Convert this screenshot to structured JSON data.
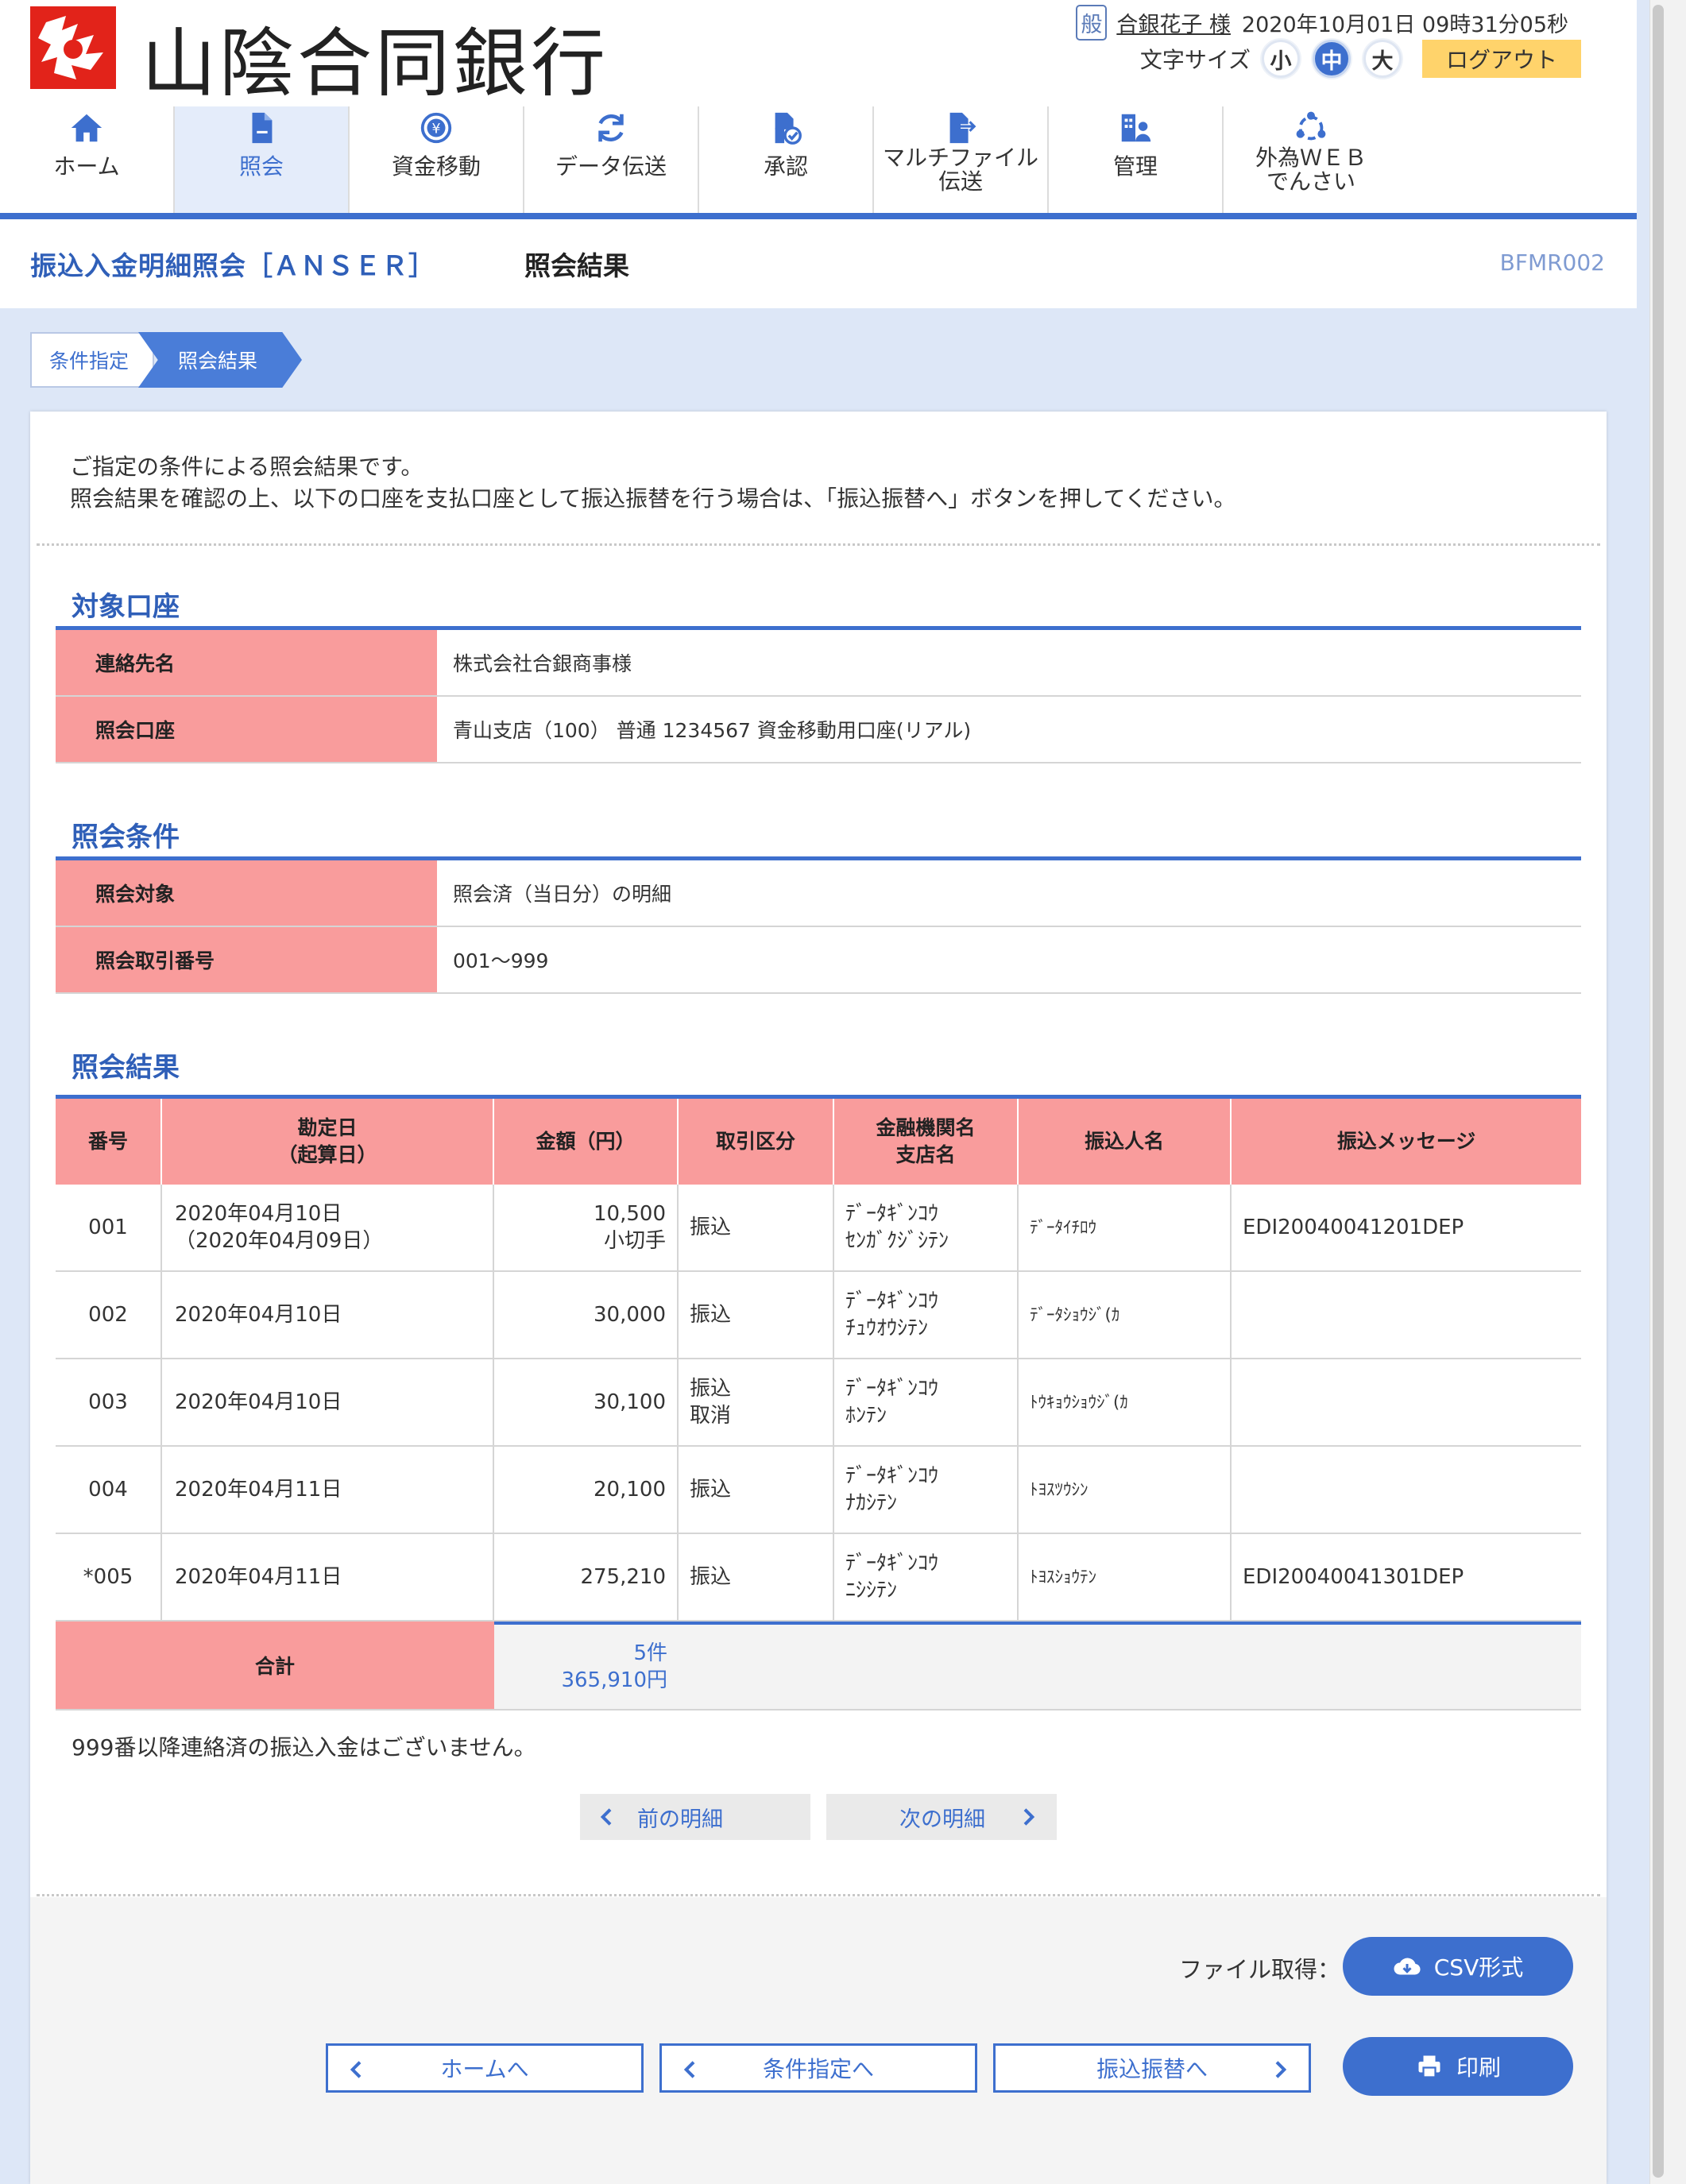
{
  "header": {
    "bank_name": "山陰合同銀行",
    "user_badge": "般",
    "user_name": "合銀花子 様",
    "datetime": "2020年10月01日 09時31分05秒",
    "font_size_label": "文字サイズ",
    "font_sizes": [
      "小",
      "中",
      "大"
    ],
    "font_size_selected": "中",
    "logout": "ログアウト"
  },
  "nav": {
    "items": [
      {
        "label": "ホーム",
        "icon": "home-icon"
      },
      {
        "label": "照会",
        "icon": "document-icon"
      },
      {
        "label": "資金移動",
        "icon": "yen-transfer-icon"
      },
      {
        "label": "データ伝送",
        "icon": "sync-icon"
      },
      {
        "label": "承認",
        "icon": "approve-document-icon"
      },
      {
        "label": "マルチファイル",
        "label2": "伝送",
        "icon": "file-upload-icon"
      },
      {
        "label": "管理",
        "icon": "admin-user-icon"
      },
      {
        "label": "外為ＷＥＢ",
        "label2": "でんさい",
        "icon": "network-icon"
      }
    ],
    "active": "照会"
  },
  "title": {
    "main": "振込入金明細照会［ＡＮＳＥＲ］",
    "sub": "照会結果",
    "screen_id": "BFMR002"
  },
  "steps": [
    "条件指定",
    "照会結果"
  ],
  "intro": {
    "line1": "ご指定の条件による照会結果です。",
    "line2": "照会結果を確認の上、以下の口座を支払口座として振込振替を行う場合は、「振込振替へ」ボタンを押してください。"
  },
  "target_account": {
    "title": "対象口座",
    "rows": [
      {
        "key": "連絡先名",
        "value": "株式会社合銀商事様"
      },
      {
        "key": "照会口座",
        "value": "青山支店（100） 普通 1234567 資金移動用口座(リアル)"
      }
    ]
  },
  "conditions": {
    "title": "照会条件",
    "rows": [
      {
        "key": "照会対象",
        "value": "照会済（当日分）の明細"
      },
      {
        "key": "照会取引番号",
        "value": "001～999"
      }
    ]
  },
  "results": {
    "title": "照会結果",
    "headers": {
      "no": "番号",
      "date": "勘定日",
      "date2": "（起算日）",
      "amount": "金額（円）",
      "type": "取引区分",
      "bank": "金融機関名",
      "bank2": "支店名",
      "payer": "振込人名",
      "message": "振込メッセージ"
    },
    "rows": [
      {
        "no": "001",
        "date": "2020年04月10日",
        "date2": "（2020年04月09日）",
        "amount": "10,500",
        "amount2": "小切手",
        "type": "振込",
        "type2": "",
        "bank": "ﾃﾞｰﾀｷﾞﾝｺｳ",
        "branch": "ｾﾝｶﾞｸｼﾞｼﾃﾝ",
        "payer": "ﾃﾞｰﾀｲﾁﾛｳ",
        "message": "EDI20040041201DEP"
      },
      {
        "no": "002",
        "date": "2020年04月10日",
        "date2": "",
        "amount": "30,000",
        "amount2": "",
        "type": "振込",
        "type2": "",
        "bank": "ﾃﾞｰﾀｷﾞﾝｺｳ",
        "branch": "ﾁｭｳｵｳｼﾃﾝ",
        "payer": "ﾃﾞｰﾀｼｮｳｼﾞ(ｶ",
        "message": ""
      },
      {
        "no": "003",
        "date": "2020年04月10日",
        "date2": "",
        "amount": "30,100",
        "amount2": "",
        "type": "振込",
        "type2": "取消",
        "bank": "ﾃﾞｰﾀｷﾞﾝｺｳ",
        "branch": "ﾎﾝﾃﾝ",
        "payer": "ﾄｳｷｮｳｼｮｳｼﾞ(ｶ",
        "message": ""
      },
      {
        "no": "004",
        "date": "2020年04月11日",
        "date2": "",
        "amount": "20,100",
        "amount2": "",
        "type": "振込",
        "type2": "",
        "bank": "ﾃﾞｰﾀｷﾞﾝｺｳ",
        "branch": "ﾅｶｼﾃﾝ",
        "payer": "ﾄﾖｽﾂｳｼﾝ",
        "message": ""
      },
      {
        "no": "*005",
        "date": "2020年04月11日",
        "date2": "",
        "amount": "275,210",
        "amount2": "",
        "type": "振込",
        "type2": "",
        "bank": "ﾃﾞｰﾀｷﾞﾝｺｳ",
        "branch": "ﾆｼｼﾃﾝ",
        "payer": "ﾄﾖｽｼｮｳﾃﾝ",
        "message": "EDI20040041301DEP"
      }
    ],
    "total_label": "合計",
    "total_count": "5件",
    "total_amount": "365,910円"
  },
  "no_more_notice": "999番以降連絡済の振込入金はございません。",
  "paging": {
    "prev": "前の明細",
    "next": "次の明細"
  },
  "footer": {
    "file_label": "ファイル取得：",
    "csv": "CSV形式",
    "print": "印刷",
    "home": "ホームへ",
    "conditions": "条件指定へ",
    "transfer": "振込振替へ"
  },
  "colors": {
    "accent": "#3d6fce",
    "header_cell": "#f99c9c",
    "logout": "#ffd36b",
    "logo": "#e2231a"
  }
}
